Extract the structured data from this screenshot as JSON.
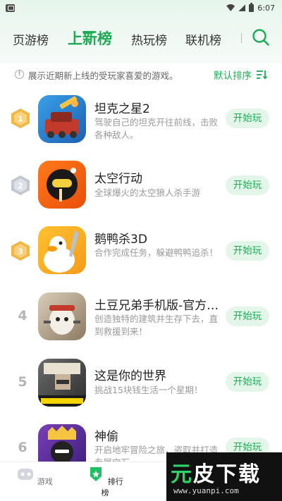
{
  "status_bar": {
    "time": "6:07"
  },
  "tabs": [
    {
      "label": "页游榜"
    },
    {
      "label": "上新榜"
    },
    {
      "label": "热玩榜"
    },
    {
      "label": "联机榜"
    }
  ],
  "info": {
    "text": "展示近期新上线的受玩家喜爱的游戏。",
    "sort_label": "默认排序"
  },
  "apps": [
    {
      "rank": "1",
      "name": "坦克之星2",
      "desc": "驾驶自己的坦克开往前线，击败各种敌人。",
      "button": "开始玩"
    },
    {
      "rank": "2",
      "name": "太空行动",
      "desc": "全球爆火的太空狼人杀手游",
      "button": "开始玩"
    },
    {
      "rank": "3",
      "name": "鹅鸭杀3D",
      "desc": "合作完成任务，躲避鸭鸭追杀！",
      "button": "开始玩"
    },
    {
      "rank": "4",
      "name": "土豆兄弟手机版-官方…",
      "desc": "创造独特的建筑并生存下去，直到救援到来！",
      "button": "开始玩"
    },
    {
      "rank": "5",
      "name": "这是你的世界",
      "desc": "挑战15块钱生活一个星期！",
      "button": "开始玩"
    },
    {
      "rank": "6",
      "name": "神偷",
      "desc": "开启地牢冒险之旅，盗取并打造专属宝石",
      "button": "开始玩"
    }
  ],
  "bottom_nav": [
    {
      "label": "游戏"
    },
    {
      "label": "排行榜"
    }
  ],
  "watermark": {
    "text_green": "元",
    "text_white": "皮下载",
    "url": "www.yuanpi.com"
  },
  "colors": {
    "accent": "#1faa55",
    "button_bg": "#e4f5ea",
    "gold": "#f0b646",
    "silver": "#c3c7cf"
  }
}
